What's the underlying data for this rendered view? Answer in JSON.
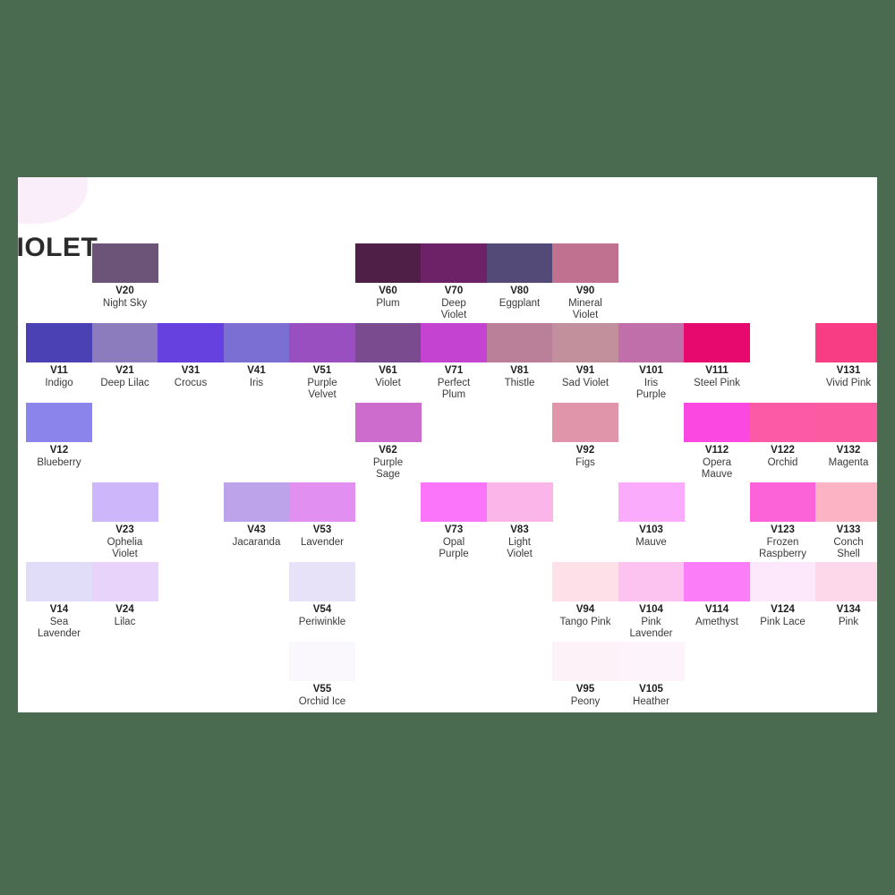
{
  "page": {
    "background_color": "#4a6b4f",
    "card_background": "#ffffff",
    "section_title": "VIOLET"
  },
  "chart_data": {
    "type": "table",
    "title": "VIOLET",
    "columns": [
      {
        "family": "V1x",
        "swatches": [
          {
            "row": 2,
            "code": "V11",
            "name": "Indigo",
            "color": "#4b41b4"
          },
          {
            "row": 3,
            "code": "V12",
            "name": "Blueberry",
            "color": "#8b84ea"
          },
          {
            "row": 5,
            "code": "V14",
            "name": "Sea Lavender",
            "color": "#e1dcf8"
          }
        ]
      },
      {
        "family": "V2x",
        "swatches": [
          {
            "row": 1,
            "code": "V20",
            "name": "Night Sky",
            "color": "#6b5478"
          },
          {
            "row": 2,
            "code": "V21",
            "name": "Deep Lilac",
            "color": "#8c7cbd"
          },
          {
            "row": 4,
            "code": "V23",
            "name": "Ophelia Violet",
            "color": "#cdb6fa"
          },
          {
            "row": 5,
            "code": "V24",
            "name": "Lilac",
            "color": "#e8d3fa"
          }
        ]
      },
      {
        "family": "V3x",
        "swatches": [
          {
            "row": 2,
            "code": "V31",
            "name": "Crocus",
            "color": "#6740e0"
          }
        ]
      },
      {
        "family": "V4x",
        "swatches": [
          {
            "row": 2,
            "code": "V41",
            "name": "Iris",
            "color": "#7b6fd4"
          },
          {
            "row": 4,
            "code": "V43",
            "name": "Jacaranda",
            "color": "#bda3ea"
          }
        ]
      },
      {
        "family": "V5x",
        "swatches": [
          {
            "row": 2,
            "code": "V51",
            "name": "Purple Velvet",
            "color": "#9a4fc0"
          },
          {
            "row": 4,
            "code": "V53",
            "name": "Lavender",
            "color": "#e18ff0"
          },
          {
            "row": 5,
            "code": "V54",
            "name": "Periwinkle",
            "color": "#e8e2f8"
          },
          {
            "row": 6,
            "code": "V55",
            "name": "Orchid Ice",
            "color": "#faf7fd"
          }
        ]
      },
      {
        "family": "V6x",
        "swatches": [
          {
            "row": 1,
            "code": "V60",
            "name": "Plum",
            "color": "#4f1f47"
          },
          {
            "row": 2,
            "code": "V61",
            "name": "Violet",
            "color": "#7a4b8f"
          },
          {
            "row": 3,
            "code": "V62",
            "name": "Purple Sage",
            "color": "#ce6cce"
          }
        ]
      },
      {
        "family": "V7x",
        "swatches": [
          {
            "row": 1,
            "code": "V70",
            "name": "Deep Violet",
            "color": "#6d2268"
          },
          {
            "row": 2,
            "code": "V71",
            "name": "Perfect Plum",
            "color": "#c443d1"
          },
          {
            "row": 4,
            "code": "V73",
            "name": "Opal Purple",
            "color": "#fa75fa"
          }
        ]
      },
      {
        "family": "V8x",
        "swatches": [
          {
            "row": 1,
            "code": "V80",
            "name": "Eggplant",
            "color": "#544a77"
          },
          {
            "row": 2,
            "code": "V81",
            "name": "Thistle",
            "color": "#bb8099"
          },
          {
            "row": 4,
            "code": "V83",
            "name": "Light Violet",
            "color": "#fcb5e8"
          }
        ]
      },
      {
        "family": "V9x",
        "swatches": [
          {
            "row": 1,
            "code": "V90",
            "name": "Mineral Violet",
            "color": "#c0718f"
          },
          {
            "row": 2,
            "code": "V91",
            "name": "Sad Violet",
            "color": "#c2909c"
          },
          {
            "row": 3,
            "code": "V92",
            "name": "Figs",
            "color": "#e195ab"
          },
          {
            "row": 5,
            "code": "V94",
            "name": "Tango Pink",
            "color": "#fde0e8"
          },
          {
            "row": 6,
            "code": "V95",
            "name": "Peony",
            "color": "#fdf2f8"
          }
        ]
      },
      {
        "family": "V10x",
        "swatches": [
          {
            "row": 2,
            "code": "V101",
            "name": "Iris Purple",
            "color": "#c16fab"
          },
          {
            "row": 4,
            "code": "V103",
            "name": "Mauve",
            "color": "#fbabfb"
          },
          {
            "row": 5,
            "code": "V104",
            "name": "Pink Lavender",
            "color": "#fcc2f0"
          },
          {
            "row": 6,
            "code": "V105",
            "name": "Heather",
            "color": "#fdf4fb"
          }
        ]
      },
      {
        "family": "V11x",
        "swatches": [
          {
            "row": 2,
            "code": "V111",
            "name": "Steel Pink",
            "color": "#e8096e"
          },
          {
            "row": 3,
            "code": "V112",
            "name": "Opera Mauve",
            "color": "#fa48e0"
          },
          {
            "row": 5,
            "code": "V114",
            "name": "Amethyst",
            "color": "#fb7ef8"
          }
        ]
      },
      {
        "family": "V12x",
        "swatches": [
          {
            "row": 3,
            "code": "V122",
            "name": "Orchid",
            "color": "#fc5aa6"
          },
          {
            "row": 4,
            "code": "V123",
            "name": "Frozen Raspberry",
            "color": "#fc63d8"
          },
          {
            "row": 5,
            "code": "V124",
            "name": "Pink Lace",
            "color": "#fce8fa"
          }
        ]
      },
      {
        "family": "V13x",
        "swatches": [
          {
            "row": 2,
            "code": "V131",
            "name": "Vivid Pink",
            "color": "#f83d85"
          },
          {
            "row": 3,
            "code": "V132",
            "name": "Magenta",
            "color": "#fb5ba0"
          },
          {
            "row": 4,
            "code": "V133",
            "name": "Conch Shell",
            "color": "#fcb4c4"
          },
          {
            "row": 5,
            "code": "V134",
            "name": "Pink",
            "color": "#fcd8ea"
          }
        ]
      }
    ]
  }
}
